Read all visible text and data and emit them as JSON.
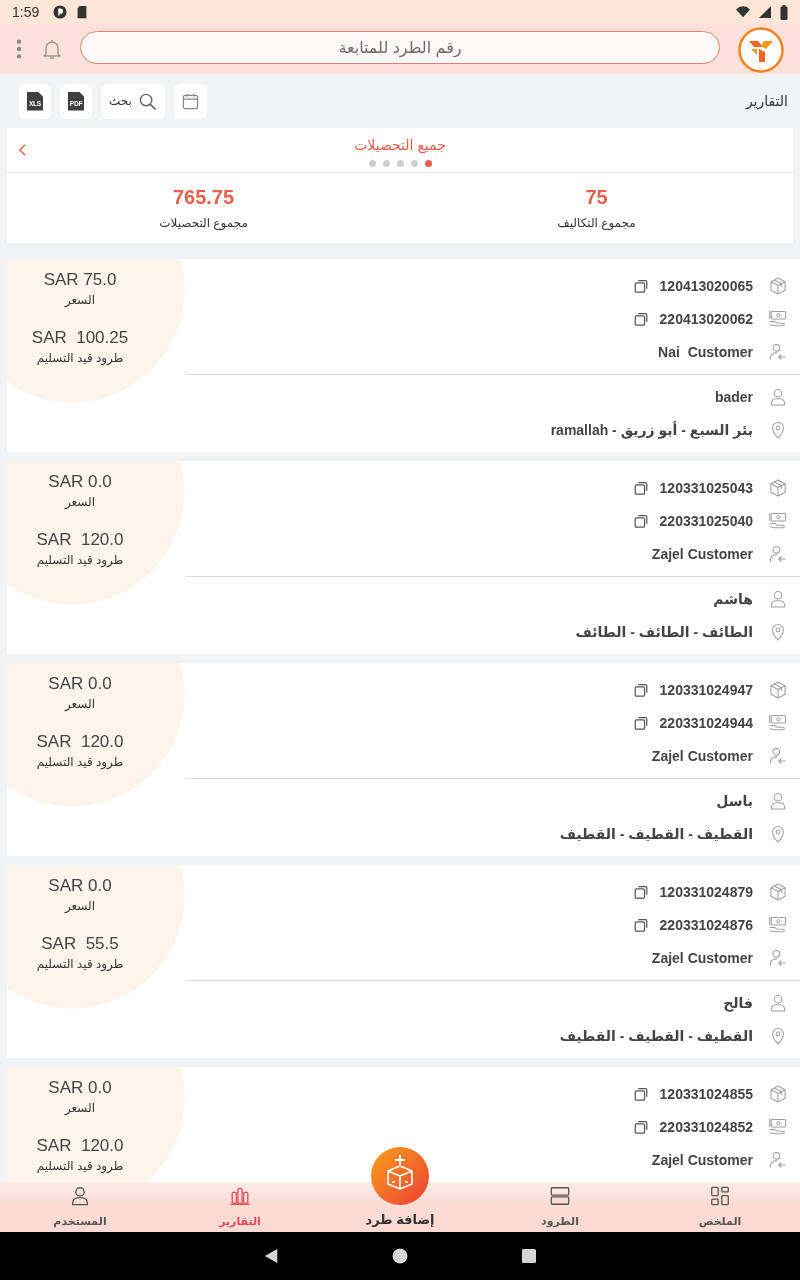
{
  "status_bar": {
    "time": "1:59"
  },
  "header": {
    "search": {
      "placeholder": "رقم الطرد للمتابعة"
    }
  },
  "toolbar": {
    "title": "التقارير",
    "search_label": "بحث",
    "export_buttons": [
      "PDF",
      "XLS"
    ]
  },
  "summary": {
    "title": "جميع التحصيلات",
    "dots": [
      {
        "selected": true
      },
      {
        "selected": false
      },
      {
        "selected": false
      },
      {
        "selected": false
      },
      {
        "selected": false
      }
    ],
    "stats": [
      {
        "value": "75",
        "label": "مجموع التكاليف"
      },
      {
        "value": "765.75",
        "label": "مجموع التحصيلات"
      }
    ]
  },
  "parcels": [
    {
      "tracking_number": "120413020065",
      "reference_number": "220413020062",
      "customer": "Nai  Customer",
      "recipient": "bader",
      "address": "بئر السبع - أبو زريق - ramallah",
      "price": "SAR 75.0",
      "price_label": "السعر",
      "pending": "SAR  100.25",
      "pending_label": "طرود قيد التسليم"
    },
    {
      "tracking_number": "120331025043",
      "reference_number": "220331025040",
      "customer": "Zajel Customer",
      "recipient": "هاشم",
      "address": "الطائف - الطائف - الطائف",
      "price": "SAR 0.0",
      "price_label": "السعر",
      "pending": "SAR  120.0",
      "pending_label": "طرود قيد التسليم"
    },
    {
      "tracking_number": "120331024947",
      "reference_number": "220331024944",
      "customer": "Zajel Customer",
      "recipient": "باسل",
      "address": "القطيف - القطيف - القطيف",
      "price": "SAR 0.0",
      "price_label": "السعر",
      "pending": "SAR  120.0",
      "pending_label": "طرود قيد التسليم"
    },
    {
      "tracking_number": "120331024879",
      "reference_number": "220331024876",
      "customer": "Zajel Customer",
      "recipient": "فالح",
      "address": "القطيف - القطيف - القطيف",
      "price": "SAR 0.0",
      "price_label": "السعر",
      "pending": "SAR  55.5",
      "pending_label": "طرود قيد التسليم"
    },
    {
      "tracking_number": "120331024855",
      "reference_number": "220331024852",
      "customer": "Zajel Customer",
      "price": "SAR 0.0",
      "price_label": "السعر",
      "pending": "SAR  120.0",
      "pending_label": "طرود قيد التسليم"
    }
  ],
  "bottom_nav": [
    {
      "label": "الملخص",
      "kind": "tab",
      "selected": false
    },
    {
      "label": "الطرود",
      "kind": "tab",
      "selected": false
    },
    {
      "label": "إضافة طرد",
      "kind": "action",
      "selected": false
    },
    {
      "label": "التقارير",
      "kind": "tab",
      "selected": true
    },
    {
      "label": "المستخدم",
      "kind": "tab",
      "selected": false
    }
  ]
}
